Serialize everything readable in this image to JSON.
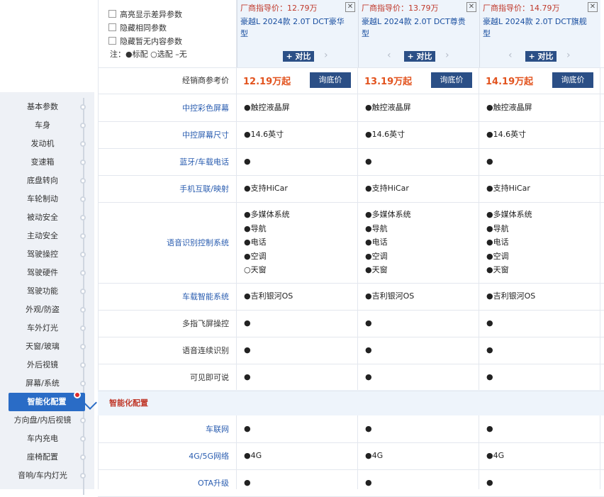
{
  "options": {
    "highlight_diff": "高亮显示差异参数",
    "hide_same": "隐藏相同参数",
    "hide_empty": "隐藏暂无内容参数",
    "legend": "注：●标配 ○选配 –无"
  },
  "cars": [
    {
      "price_label": "厂商指导价：12.79万",
      "name": "豪越L 2024款 2.0T DCT豪华型",
      "compare": "+ 对比",
      "dealer_price": "12.19万起",
      "inquire": "询底价"
    },
    {
      "price_label": "厂商指导价：13.79万",
      "name": "豪越L 2024款 2.0T DCT尊贵型",
      "compare": "+ 对比",
      "dealer_price": "13.19万起",
      "inquire": "询底价"
    },
    {
      "price_label": "厂商指导价：14.79万",
      "name": "豪越L 2024款 2.0T DCT旗舰型",
      "compare": "+ 对比",
      "dealer_price": "14.19万起",
      "inquire": "询底价"
    }
  ],
  "dealer_label": "经销商参考价",
  "nav": [
    "基本参数",
    "车身",
    "发动机",
    "变速箱",
    "底盘转向",
    "车轮制动",
    "被动安全",
    "主动安全",
    "驾驶操控",
    "驾驶硬件",
    "驾驶功能",
    "外观/防盗",
    "车外灯光",
    "天窗/玻璃",
    "外后视镜",
    "屏幕/系统",
    "智能化配置",
    "方向盘/内后视镜",
    "车内充电",
    "座椅配置",
    "音响/车内灯光"
  ],
  "active_nav": "智能化配置",
  "rows": [
    {
      "label": "中控彩色屏幕",
      "values": [
        "●触控液晶屏",
        "●触控液晶屏",
        "●触控液晶屏"
      ]
    },
    {
      "label": "中控屏幕尺寸",
      "values": [
        "●14.6英寸",
        "●14.6英寸",
        "●14.6英寸"
      ]
    },
    {
      "label": "蓝牙/车载电话",
      "values": [
        "●",
        "●",
        "●"
      ]
    },
    {
      "label": "手机互联/映射",
      "values": [
        "●支持HiCar",
        "●支持HiCar",
        "●支持HiCar"
      ]
    },
    {
      "label": "语音识别控制系统",
      "values": [
        [
          "●多媒体系统",
          "●导航",
          "●电话",
          "●空调",
          "○天窗"
        ],
        [
          "●多媒体系统",
          "●导航",
          "●电话",
          "●空调",
          "●天窗"
        ],
        [
          "●多媒体系统",
          "●导航",
          "●电话",
          "●空调",
          "●天窗"
        ]
      ]
    },
    {
      "label": "车载智能系统",
      "values": [
        "●吉利银河OS",
        "●吉利银河OS",
        "●吉利银河OS"
      ]
    },
    {
      "label": "多指飞屏操控",
      "values": [
        "●",
        "●",
        "●"
      ]
    },
    {
      "label": "语音连续识别",
      "values": [
        "●",
        "●",
        "●"
      ]
    },
    {
      "label": "可见即可说",
      "values": [
        "●",
        "●",
        "●"
      ]
    }
  ],
  "section_title": "智能化配置",
  "section_rows": [
    {
      "label": "车联网",
      "values": [
        "●",
        "●",
        "●"
      ]
    },
    {
      "label": "4G/5G网络",
      "values": [
        "●4G",
        "●4G",
        "●4G"
      ]
    },
    {
      "label": "OTA升级",
      "values": [
        "●",
        "●",
        "●"
      ]
    }
  ]
}
